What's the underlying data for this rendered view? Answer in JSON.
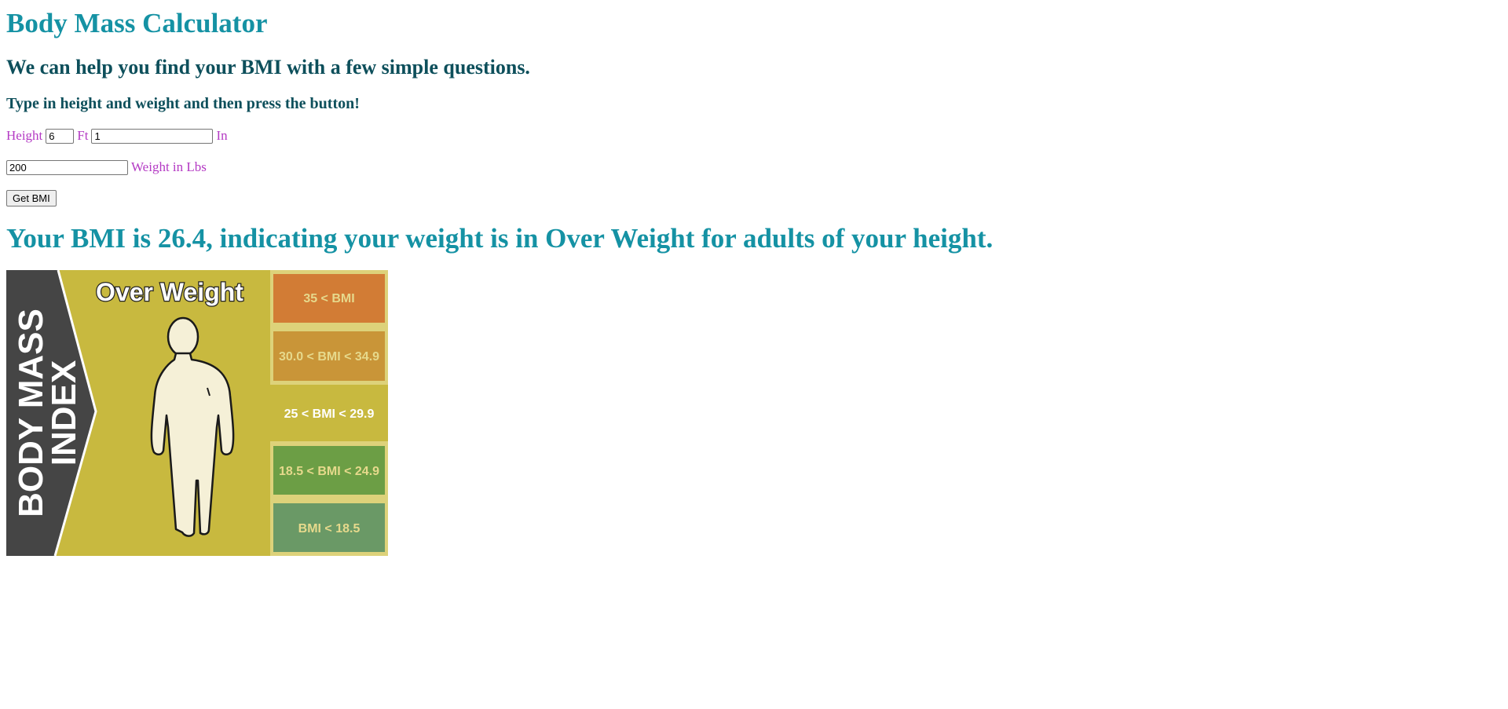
{
  "header": {
    "title": "Body Mass Calculator",
    "subtitle": "We can help you find your BMI with a few simple questions.",
    "instructions": "Type in height and weight and then press the button!"
  },
  "form": {
    "height_label": "Height",
    "feet_value": "6",
    "feet_unit": "Ft",
    "inches_value": "1",
    "inches_unit": "In",
    "weight_value": "200",
    "weight_label": "Weight in Lbs",
    "submit_label": "Get BMI"
  },
  "result": {
    "message": "Your BMI is 26.4, indicating your weight is in Over Weight for adults of your height."
  },
  "figure": {
    "side_title_line1": "BODY MASS",
    "side_title_line2": "INDEX",
    "category_title": "Over Weight",
    "ranges": [
      "35 < BMI",
      "30.0 < BMI < 34.9",
      "25 < BMI < 29.9",
      "18.5 < BMI < 24.9",
      "BMI < 18.5"
    ],
    "icon": "body-silhouette-icon",
    "colors": {
      "sidebar": "#454545",
      "background": "#c8b93f",
      "range_frame": "#ddd27a",
      "range_1": "#d27c35",
      "range_2": "#c99538",
      "range_3": "#c8b93f",
      "range_4": "#6c9e45",
      "range_5": "#6a9966",
      "range_text": "#e6d98c",
      "range_text_active": "#ffffff"
    }
  }
}
